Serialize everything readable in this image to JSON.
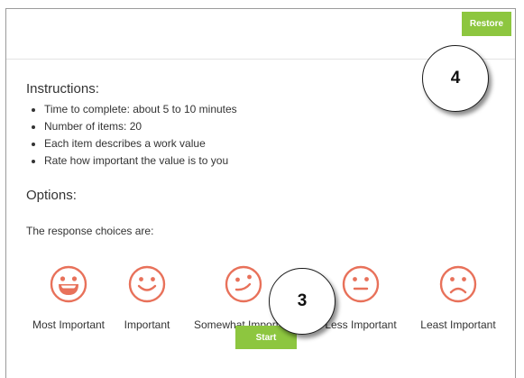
{
  "header": {
    "restore_label": "Restore"
  },
  "callouts": {
    "top": "4",
    "middle": "3"
  },
  "instructions": {
    "heading": "Instructions:",
    "items": [
      "Time to complete: about 5 to 10 minutes",
      "Number of items: 20",
      "Each item describes a work value",
      "Rate how important the value is to you"
    ]
  },
  "options": {
    "heading": "Options:",
    "intro": "The response choices are:",
    "choices": [
      {
        "label": "Most Important",
        "icon": "laughing-face-icon"
      },
      {
        "label": "Important",
        "icon": "smiling-face-icon"
      },
      {
        "label": "Somewhat Important",
        "icon": "smirking-face-icon"
      },
      {
        "label": "Less Important",
        "icon": "neutral-face-icon"
      },
      {
        "label": "Least Important",
        "icon": "frowning-face-icon"
      }
    ]
  },
  "footer": {
    "start_label": "Start"
  },
  "colors": {
    "accent_green": "#8dc63f",
    "face_orange": "#e8715a"
  }
}
